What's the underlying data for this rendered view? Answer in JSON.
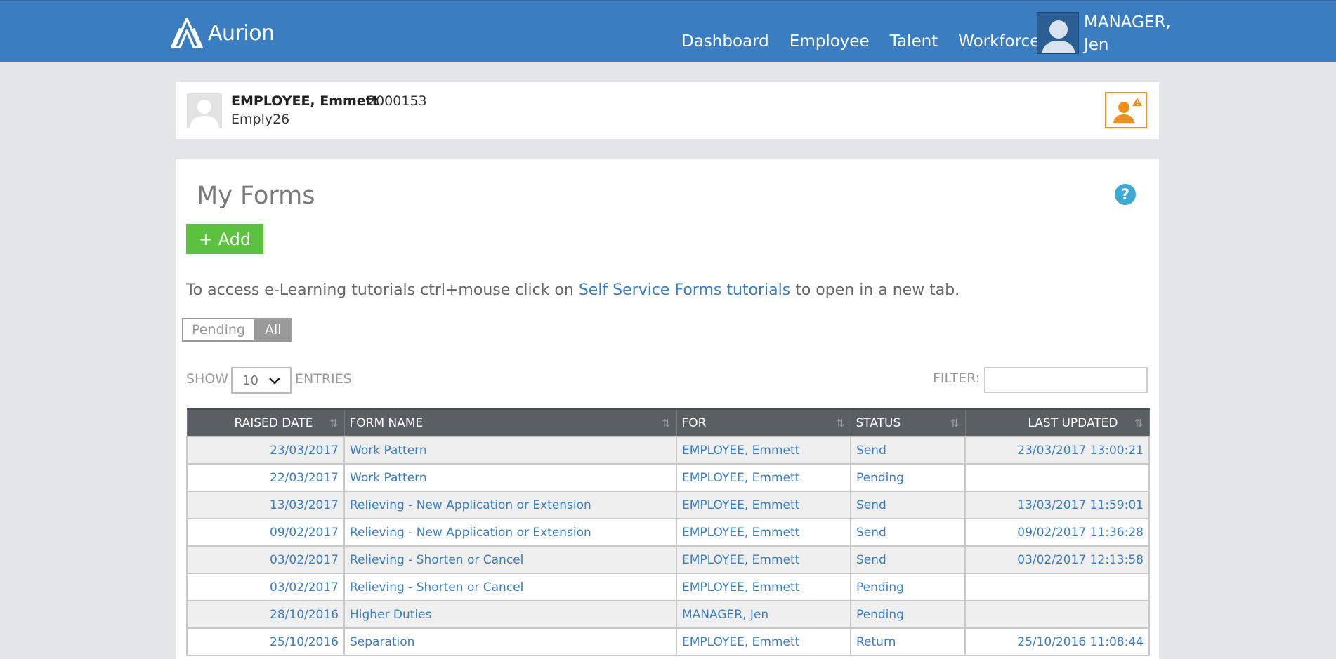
{
  "header": {
    "logo_text": "Aurion",
    "nav": [
      "Dashboard",
      "Employee",
      "Talent",
      "Workforce"
    ],
    "user_name_line1": "MANAGER,",
    "user_name_line2": "Jen"
  },
  "employee": {
    "name": "EMPLOYEE, Emmett",
    "number": "2000153",
    "username": "Emply26"
  },
  "main": {
    "title": "My Forms",
    "add_label": "+ Add",
    "info_prefix": "To access e-Learning tutorials ctrl+mouse click on ",
    "info_link": "Self Service Forms tutorials",
    "info_suffix": " to open in a new tab.",
    "toggle_pending": "Pending",
    "toggle_all": "All",
    "toggle_active": "All",
    "show_label": "SHOW",
    "show_value": "10",
    "entries_label": "ENTRIES",
    "filter_label": "FILTER:",
    "filter_value": ""
  },
  "table": {
    "columns": [
      "RAISED DATE",
      "FORM NAME",
      "FOR",
      "STATUS",
      "LAST UPDATED"
    ],
    "rows": [
      {
        "raised": "23/03/2017",
        "form": "Work Pattern",
        "for": "EMPLOYEE, Emmett",
        "status": "Send",
        "updated": "23/03/2017 13:00:21"
      },
      {
        "raised": "22/03/2017",
        "form": "Work Pattern",
        "for": "EMPLOYEE, Emmett",
        "status": "Pending",
        "updated": ""
      },
      {
        "raised": "13/03/2017",
        "form": "Relieving - New Application or Extension",
        "for": "EMPLOYEE, Emmett",
        "status": "Send",
        "updated": "13/03/2017 11:59:01"
      },
      {
        "raised": "09/02/2017",
        "form": "Relieving - New Application or Extension",
        "for": "EMPLOYEE, Emmett",
        "status": "Send",
        "updated": "09/02/2017 11:36:28"
      },
      {
        "raised": "03/02/2017",
        "form": "Relieving - Shorten or Cancel",
        "for": "EMPLOYEE, Emmett",
        "status": "Send",
        "updated": "03/02/2017 12:13:58"
      },
      {
        "raised": "03/02/2017",
        "form": "Relieving - Shorten or Cancel",
        "for": "EMPLOYEE, Emmett",
        "status": "Pending",
        "updated": ""
      },
      {
        "raised": "28/10/2016",
        "form": "Higher Duties",
        "for": "MANAGER, Jen",
        "status": "Pending",
        "updated": ""
      },
      {
        "raised": "25/10/2016",
        "form": "Separation",
        "for": "EMPLOYEE, Emmett",
        "status": "Return",
        "updated": "25/10/2016 11:08:44"
      }
    ]
  },
  "colors": {
    "topbar": "#3a7dc0",
    "add_button": "#5cc13e",
    "link": "#3a7dc0",
    "alert": "#f0901e",
    "table_header": "#5a5f63"
  },
  "icons": {
    "logo": "aurion-logo-icon",
    "user": "user-avatar-icon",
    "alert": "person-warning-icon",
    "help": "help-icon",
    "sort": "sort-icon",
    "dropdown": "chevron-down-icon"
  }
}
